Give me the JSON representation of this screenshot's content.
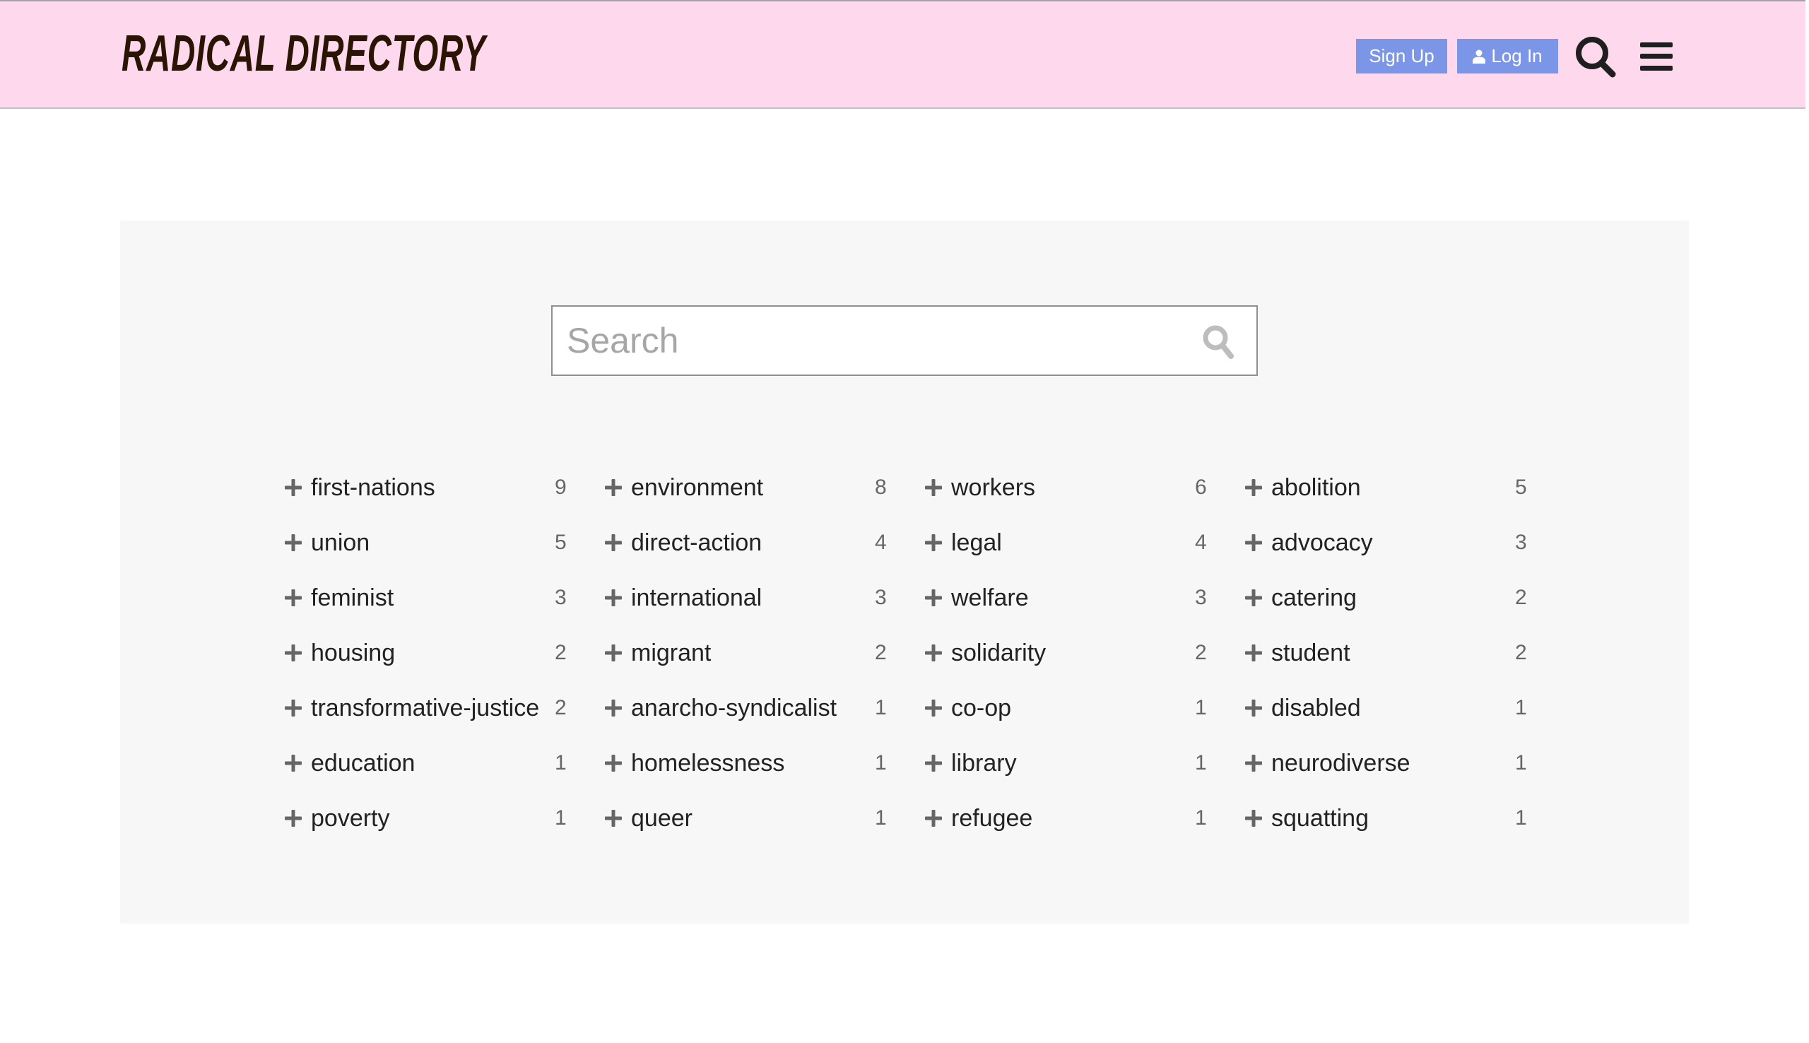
{
  "header": {
    "brand": "RADICAL DIRECTORY",
    "signup_label": "Sign Up",
    "login_label": "Log In",
    "search_icon": "search-icon",
    "menu_icon": "hamburger-menu-icon",
    "user_icon": "user-icon"
  },
  "colors": {
    "header_bg": "#fed9ee",
    "button_bg": "#7b96e6",
    "brand_text": "#2a1505",
    "panel_bg": "#f7f7f7"
  },
  "search": {
    "placeholder": "Search",
    "value": "",
    "icon": "search-icon"
  },
  "tags": {
    "columns": [
      [
        {
          "name": "first-nations",
          "count": "9"
        },
        {
          "name": "union",
          "count": "5"
        },
        {
          "name": "feminist",
          "count": "3"
        },
        {
          "name": "housing",
          "count": "2"
        },
        {
          "name": "transformative-justice",
          "count": "2"
        },
        {
          "name": "education",
          "count": "1"
        },
        {
          "name": "poverty",
          "count": "1"
        }
      ],
      [
        {
          "name": "environment",
          "count": "8"
        },
        {
          "name": "direct-action",
          "count": "4"
        },
        {
          "name": "international",
          "count": "3"
        },
        {
          "name": "migrant",
          "count": "2"
        },
        {
          "name": "anarcho-syndicalist",
          "count": "1"
        },
        {
          "name": "homelessness",
          "count": "1"
        },
        {
          "name": "queer",
          "count": "1"
        }
      ],
      [
        {
          "name": "workers",
          "count": "6"
        },
        {
          "name": "legal",
          "count": "4"
        },
        {
          "name": "welfare",
          "count": "3"
        },
        {
          "name": "solidarity",
          "count": "2"
        },
        {
          "name": "co-op",
          "count": "1"
        },
        {
          "name": "library",
          "count": "1"
        },
        {
          "name": "refugee",
          "count": "1"
        }
      ],
      [
        {
          "name": "abolition",
          "count": "5"
        },
        {
          "name": "advocacy",
          "count": "3"
        },
        {
          "name": "catering",
          "count": "2"
        },
        {
          "name": "student",
          "count": "2"
        },
        {
          "name": "disabled",
          "count": "1"
        },
        {
          "name": "neurodiverse",
          "count": "1"
        },
        {
          "name": "squatting",
          "count": "1"
        }
      ]
    ],
    "add_icon": "plus-icon"
  }
}
